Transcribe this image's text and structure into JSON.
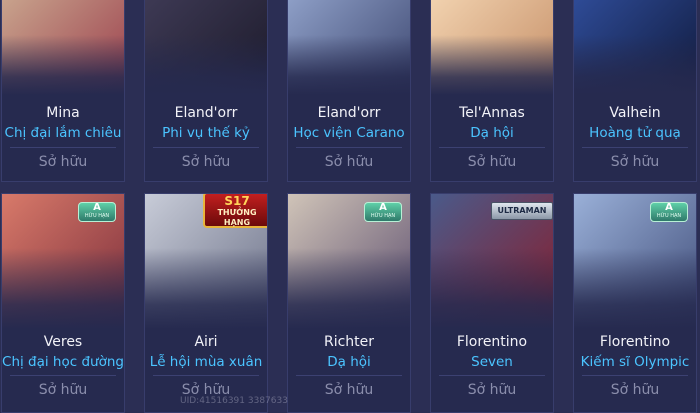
{
  "cards": [
    {
      "hero": "Mina",
      "skin": "Chị đại lắm chiêu",
      "owned": "Sở hữu",
      "art_colors": [
        "#c9a58e",
        "#9b3e4c"
      ]
    },
    {
      "hero": "Eland'orr",
      "skin": "Phi vụ thế kỷ",
      "owned": "Sở hữu",
      "art_colors": [
        "#3e3a55",
        "#1c1a2a"
      ]
    },
    {
      "hero": "Eland'orr",
      "skin": "Học viện Carano",
      "owned": "Sở hữu",
      "art_colors": [
        "#8fa0c8",
        "#3d4770"
      ]
    },
    {
      "hero": "Tel'Annas",
      "skin": "Dạ hội",
      "owned": "Sở hữu",
      "art_colors": [
        "#f2d3b0",
        "#c58e67"
      ]
    },
    {
      "hero": "Valhein",
      "skin": "Hoàng tử quạ",
      "owned": "Sở hữu",
      "art_colors": [
        "#2f4c98",
        "#101a3c"
      ]
    },
    {
      "hero": "Veres",
      "skin": "Chị đại học đường",
      "owned": "Sở hữu",
      "art_colors": [
        "#d87a6a",
        "#7a2c3a"
      ],
      "tier": {
        "grade": "A",
        "label": "HỮU HẠN"
      }
    },
    {
      "hero": "Airi",
      "skin": "Lễ hội mùa xuân",
      "owned": "Sở hữu",
      "art_colors": [
        "#c8ccd8",
        "#6a6f86"
      ],
      "badge": {
        "top": "S17",
        "bottom": "THƯỞNG HẠNG"
      }
    },
    {
      "hero": "Richter",
      "skin": "Dạ hội",
      "owned": "Sở hữu",
      "art_colors": [
        "#d0c4b8",
        "#5b4d6e"
      ],
      "tier": {
        "grade": "A",
        "label": "HỮU HẠN"
      }
    },
    {
      "hero": "Florentino",
      "skin": "Seven",
      "owned": "Sở hữu",
      "art_colors": [
        "#4a5a8a",
        "#8a1c2a"
      ],
      "badge_ultra": "ULTRAMAN"
    },
    {
      "hero": "Florentino",
      "skin": "Kiếm sĩ Olympic",
      "owned": "Sở hữu",
      "art_colors": [
        "#9ab0d8",
        "#3f4c78"
      ],
      "tier": {
        "grade": "A",
        "label": "HỮU HẠN"
      }
    }
  ],
  "uid_watermark": "UID:41516391 3387633"
}
